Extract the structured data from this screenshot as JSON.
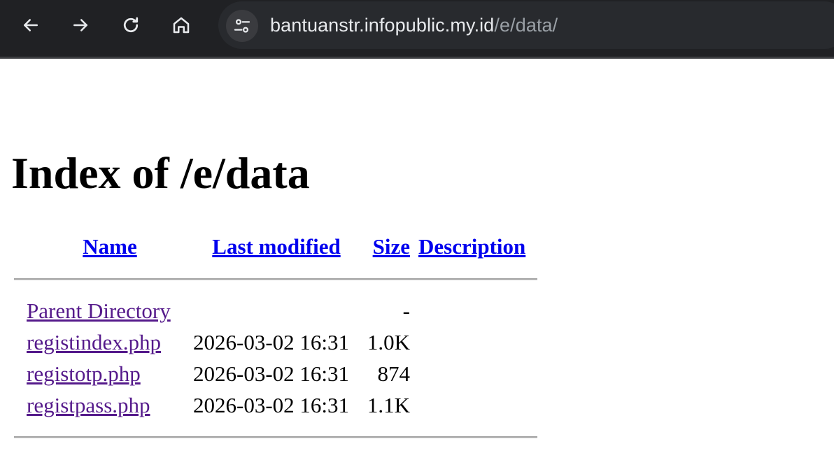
{
  "browser": {
    "url_host": "bantuanstr.infopublic.my.id",
    "url_path": "/e/data/",
    "colors": {
      "toolbar_bg": "#202124",
      "omnibox_bg": "#282a2e",
      "host_text": "#e8eaed",
      "path_text": "#9aa0a6"
    },
    "icons": [
      "back-arrow-icon",
      "forward-arrow-icon",
      "reload-icon",
      "home-icon",
      "site-settings-icon"
    ]
  },
  "page": {
    "title": "Index of /e/data",
    "columns": {
      "name": "Name",
      "last_modified": "Last modified",
      "size": "Size",
      "description": "Description"
    },
    "parent": {
      "label": "Parent Directory",
      "size": "-"
    },
    "files": [
      {
        "name": "registindex.php",
        "modified": "2026-03-02 16:31",
        "size": "1.0K",
        "description": ""
      },
      {
        "name": "registotp.php",
        "modified": "2026-03-02 16:31",
        "size": "874",
        "description": ""
      },
      {
        "name": "registpass.php",
        "modified": "2026-03-02 16:31",
        "size": "1.1K",
        "description": ""
      }
    ],
    "colors": {
      "link": "#0000ee",
      "visited_link": "#551a8b"
    }
  }
}
